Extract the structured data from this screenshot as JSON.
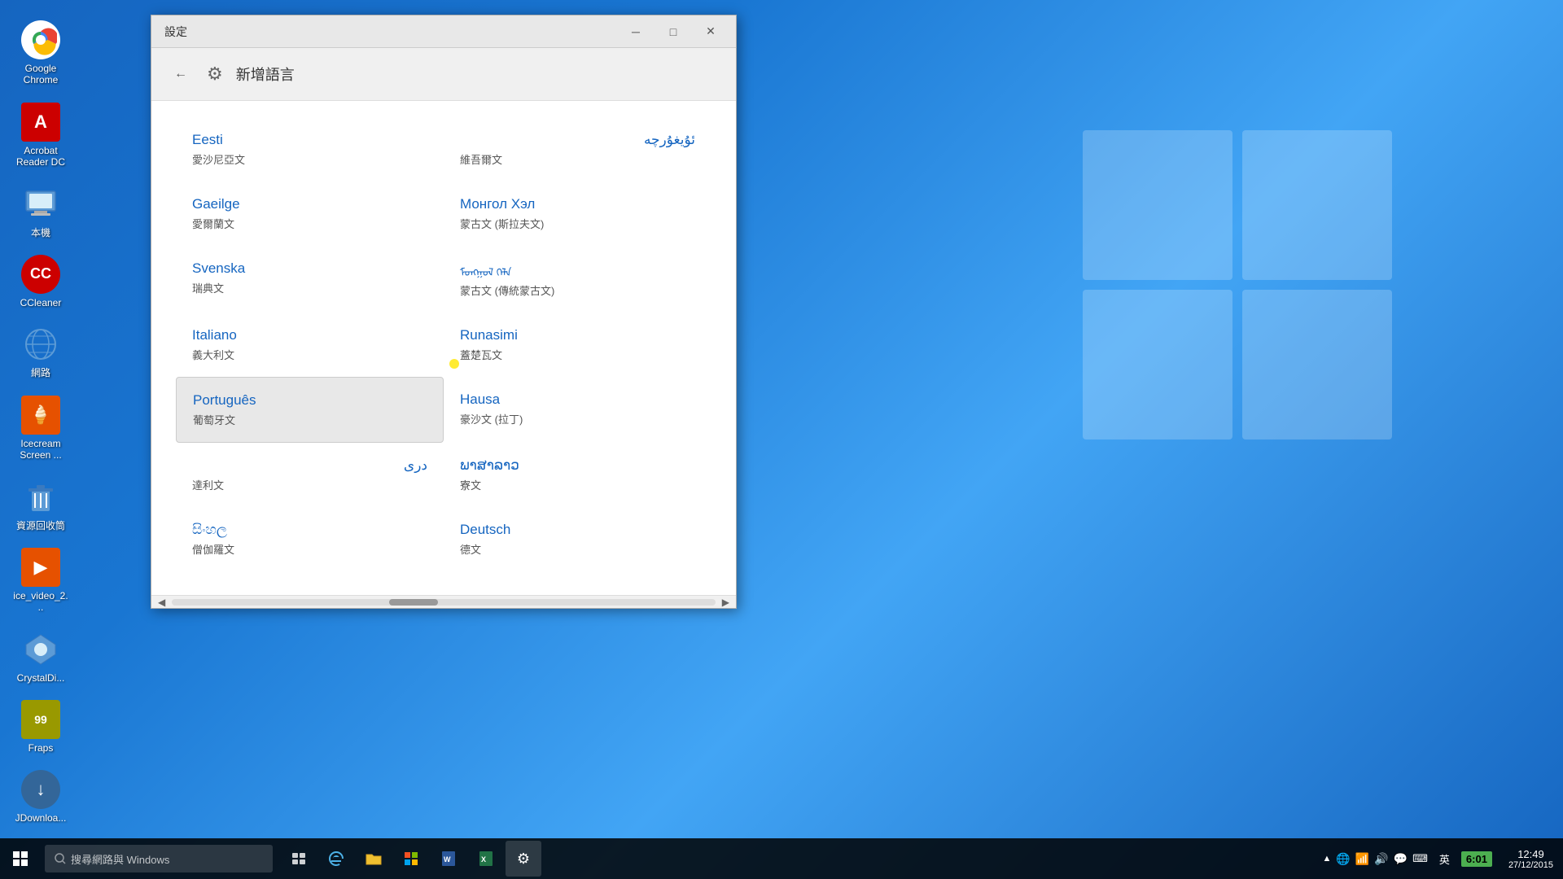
{
  "desktop": {
    "background": "#1565c0"
  },
  "desktop_icons": [
    {
      "id": "google-chrome",
      "label": "Google\nChrome",
      "icon": "chrome",
      "color": "#fff"
    },
    {
      "id": "acrobat-reader",
      "label": "Acrobat\nReader DC",
      "icon": "acrobat",
      "color": "#cc0000"
    },
    {
      "id": "my-computer",
      "label": "本機",
      "icon": "computer",
      "color": "#5c9bd6"
    },
    {
      "id": "ccleaner",
      "label": "CCleaner",
      "icon": "ccleaner",
      "color": "#cc0000"
    },
    {
      "id": "network",
      "label": "網路",
      "icon": "network",
      "color": "#5c9bd6"
    },
    {
      "id": "icecream",
      "label": "Icecream\nScreen ...",
      "icon": "icecream",
      "color": "#e65100"
    },
    {
      "id": "recycle-bin",
      "label": "資源回收筒",
      "icon": "recycle",
      "color": "#5c9bd6"
    },
    {
      "id": "ice-video",
      "label": "ice_video_2...",
      "icon": "icevideo",
      "color": "#e65100"
    },
    {
      "id": "crystaldi",
      "label": "CrystalDi...",
      "icon": "crystal",
      "color": "#5c9bd6"
    },
    {
      "id": "fraps",
      "label": "Fraps",
      "icon": "fraps",
      "color": "#aaaa00"
    },
    {
      "id": "jdownload",
      "label": "JDownloa...",
      "icon": "jdownload",
      "color": "#336699"
    }
  ],
  "taskbar": {
    "search_placeholder": "搜尋網路與 Windows",
    "items": [
      "task-view",
      "edge",
      "file-explorer",
      "store",
      "word",
      "spreadsheet",
      "settings"
    ],
    "tray_icons": [
      "chevron",
      "network",
      "globe",
      "wifi",
      "volume",
      "message",
      "keyboard"
    ],
    "time": "12:49",
    "date": "27/12/2015",
    "lang": "英",
    "battery": "6:01"
  },
  "window": {
    "title": "設定",
    "back_button": "←",
    "gear_icon": "⚙",
    "page_title": "新增語言",
    "languages": [
      {
        "id": "eesti",
        "name": "Eesti",
        "native": "愛沙尼亞文",
        "col": 0
      },
      {
        "id": "uyghur",
        "name": "ئۇيغۇرچە",
        "native": "維吾爾文",
        "col": 1,
        "rtl": true
      },
      {
        "id": "gaeilge",
        "name": "Gaeilge",
        "native": "愛爾蘭文",
        "col": 0
      },
      {
        "id": "mongolian",
        "name": "Монгол Хэл",
        "native": "蒙古文 (斯拉夫文)",
        "col": 1
      },
      {
        "id": "svenska",
        "name": "Svenska",
        "native": "瑞典文",
        "col": 0
      },
      {
        "id": "mongolian-trad",
        "name": "ᠮᠣᠩᠭᠣᠯ ᠬᠡᠯᠡ",
        "native": "蒙古文 (傳統蒙古文)",
        "col": 1
      },
      {
        "id": "italiano",
        "name": "Italiano",
        "native": "義大利文",
        "col": 0
      },
      {
        "id": "runasimi",
        "name": "Runasimi",
        "native": "蓋楚瓦文",
        "col": 1
      },
      {
        "id": "portugues",
        "name": "Português",
        "native": "葡萄牙文",
        "col": 0,
        "highlighted": true
      },
      {
        "id": "hausa",
        "name": "Hausa",
        "native": "豪沙文 (拉丁)",
        "col": 1
      },
      {
        "id": "dari",
        "name": "دری",
        "native": "達利文",
        "col": 0,
        "rtl": true
      },
      {
        "id": "lao",
        "name": "ພາສາລາວ",
        "native": "寮文",
        "col": 1
      },
      {
        "id": "sinhala",
        "name": "සිංහල",
        "native": "僧伽羅文",
        "col": 0
      },
      {
        "id": "deutsch",
        "name": "Deutsch",
        "native": "德文",
        "col": 1
      }
    ]
  }
}
